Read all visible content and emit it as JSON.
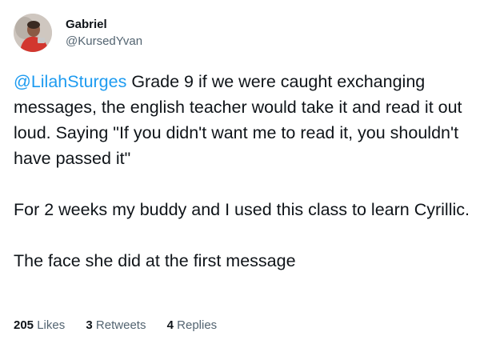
{
  "author": {
    "name": "Gabriel",
    "handle": "@KursedYvan"
  },
  "tweet": {
    "mention": "@LilahSturges",
    "paragraph_1_rest": " Grade 9 if we were caught exchanging messages, the english teacher would take it and read it out loud. Saying \"If you didn't want me to read it, you shouldn't have passed it\"",
    "paragraph_2": "For 2 weeks my buddy and I used this class to learn Cyrillic.",
    "paragraph_3": "The face she did at the first message"
  },
  "stats": {
    "likes_count": "205",
    "likes_label": "Likes",
    "retweets_count": "3",
    "retweets_label": "Retweets",
    "replies_count": "4",
    "replies_label": "Replies"
  },
  "colors": {
    "mention": "#1d9bf0",
    "secondary_text": "#536471",
    "primary_text": "#0f1419"
  }
}
